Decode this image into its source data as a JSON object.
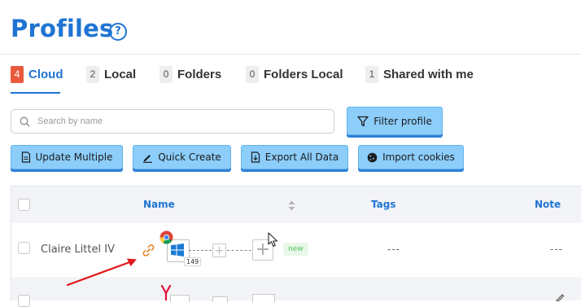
{
  "page": {
    "title": "Profiles"
  },
  "tabs": [
    {
      "count": "4",
      "label": "Cloud",
      "active": true
    },
    {
      "count": "2",
      "label": "Local"
    },
    {
      "count": "0",
      "label": "Folders"
    },
    {
      "count": "0",
      "label": "Folders Local"
    },
    {
      "count": "1",
      "label": "Shared with me"
    }
  ],
  "search": {
    "placeholder": "Search by name"
  },
  "toolbar": {
    "filter_label": "Filter profile",
    "update_multiple": "Update Multiple",
    "quick_create": "Quick Create",
    "export_all": "Export All Data",
    "import_cookies": "Import cookies"
  },
  "table": {
    "headers": {
      "name": "Name",
      "tags": "Tags",
      "note": "Note"
    },
    "rows": [
      {
        "name": "Claire Littel IV",
        "os_badge": "149",
        "status": "new",
        "tags": "---",
        "note": "---"
      }
    ]
  },
  "colors": {
    "accent": "#1f74d3",
    "button": "#8ccdfa",
    "count_active": "#e85a3c",
    "annotation": "#e0161b"
  }
}
